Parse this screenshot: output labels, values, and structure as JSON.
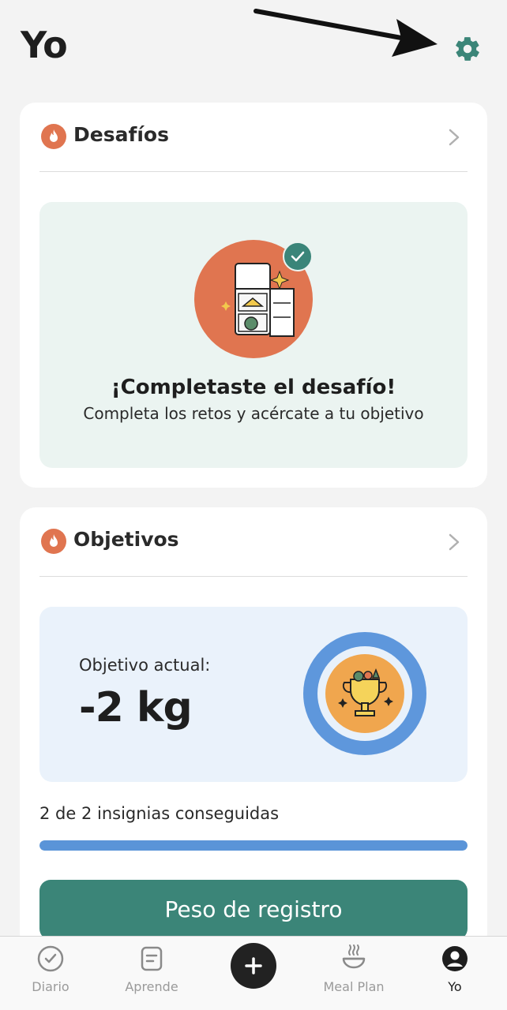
{
  "header": {
    "title": "Yo"
  },
  "desafios": {
    "title": "Desafíos",
    "completed_title": "¡Completaste el desafío!",
    "completed_subtitle": "Completa los retos y acércate a tu objetivo"
  },
  "objetivos": {
    "title": "Objetivos",
    "current_goal_label": "Objetivo actual:",
    "current_goal_value": "-2 kg",
    "badges_text": "2 de 2 insignias conseguidas",
    "badges_progress": 1.0,
    "log_button_label": "Peso de registro"
  },
  "tabbar": {
    "items": [
      {
        "label": "Diario",
        "icon": "check-circle-icon"
      },
      {
        "label": "Aprende",
        "icon": "note-icon"
      },
      {
        "label": "",
        "icon": "plus-icon"
      },
      {
        "label": "Meal Plan",
        "icon": "bowl-icon"
      },
      {
        "label": "Yo",
        "icon": "profile-icon"
      }
    ]
  },
  "colors": {
    "accent_green": "#3b8578",
    "flame_orange": "#e07550",
    "progress_blue": "#5a94d8",
    "challenge_bg": "#ebf4f1",
    "goal_bg": "#eaf2fb"
  }
}
